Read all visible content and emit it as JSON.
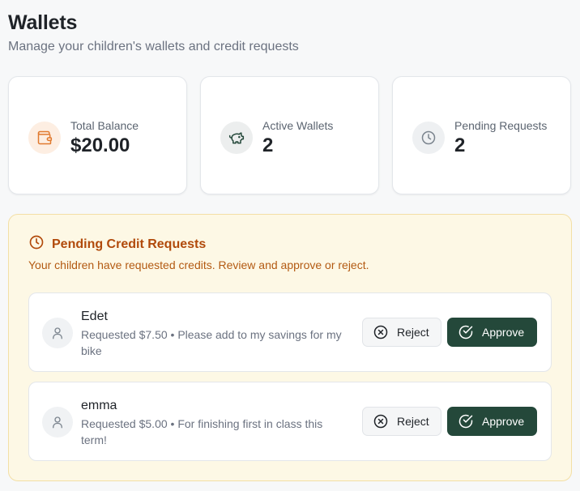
{
  "header": {
    "title": "Wallets",
    "subtitle": "Manage your children's wallets and credit requests"
  },
  "stats": [
    {
      "label": "Total Balance",
      "value": "$20.00",
      "icon": "wallet-icon"
    },
    {
      "label": "Active Wallets",
      "value": "2",
      "icon": "piggy-bank-icon"
    },
    {
      "label": "Pending Requests",
      "value": "2",
      "icon": "clock-icon"
    }
  ],
  "pending": {
    "title": "Pending Credit Requests",
    "description": "Your children have requested credits. Review and approve or reject.",
    "requests": [
      {
        "name": "Edet",
        "detail": "Requested $7.50 • Please add to my savings for my bike",
        "reject_label": "Reject",
        "approve_label": "Approve"
      },
      {
        "name": "emma",
        "detail": "Requested $5.00 • For finishing first in class this term!",
        "reject_label": "Reject",
        "approve_label": "Approve"
      }
    ]
  },
  "colors": {
    "accent_dark_green": "#24483a",
    "warning_text": "#b14a0b",
    "warning_bg": "#fdf8e5",
    "wallet_icon": "#e07a2f"
  }
}
